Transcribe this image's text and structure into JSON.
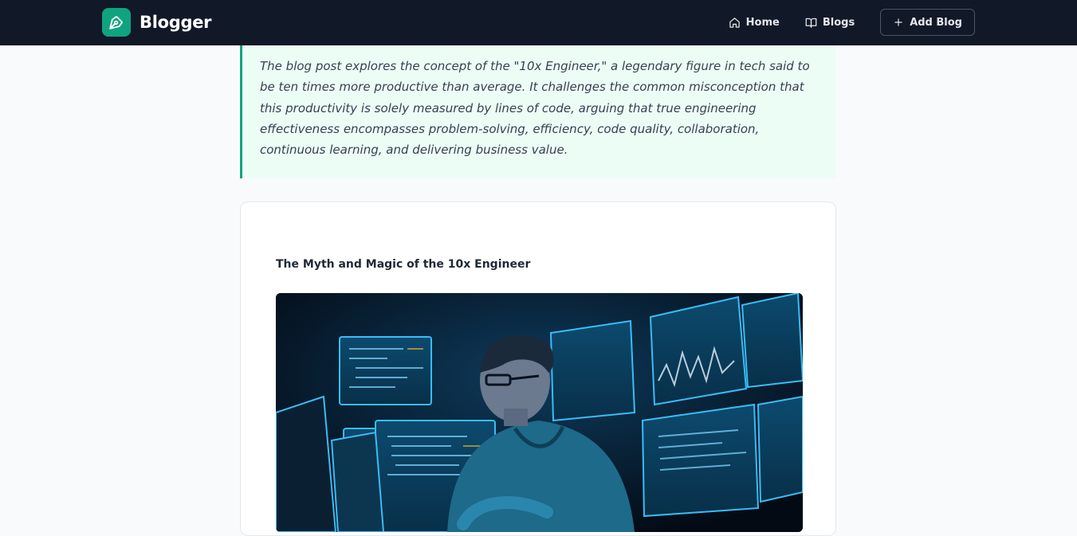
{
  "navbar": {
    "brand": "Blogger",
    "logo_icon": "pen-nib-icon",
    "links": [
      {
        "label": "Home",
        "icon": "home-icon"
      },
      {
        "label": "Blogs",
        "icon": "book-open-icon"
      }
    ],
    "add_button": {
      "label": "Add Blog",
      "icon": "plus-icon"
    },
    "colors": {
      "background": "#111827",
      "accent": "#10a37f"
    }
  },
  "summary": {
    "text": "The blog post explores the concept of the \"10x Engineer,\" a legendary figure in tech said to be ten times more productive than average. It challenges the common misconception that this productivity is solely measured by lines of code, arguing that true engineering effectiveness encompasses problem-solving, efficiency, code quality, collaboration, continuous learning, and delivering business value."
  },
  "post": {
    "title": "The Myth and Magic of the 10x Engineer"
  }
}
